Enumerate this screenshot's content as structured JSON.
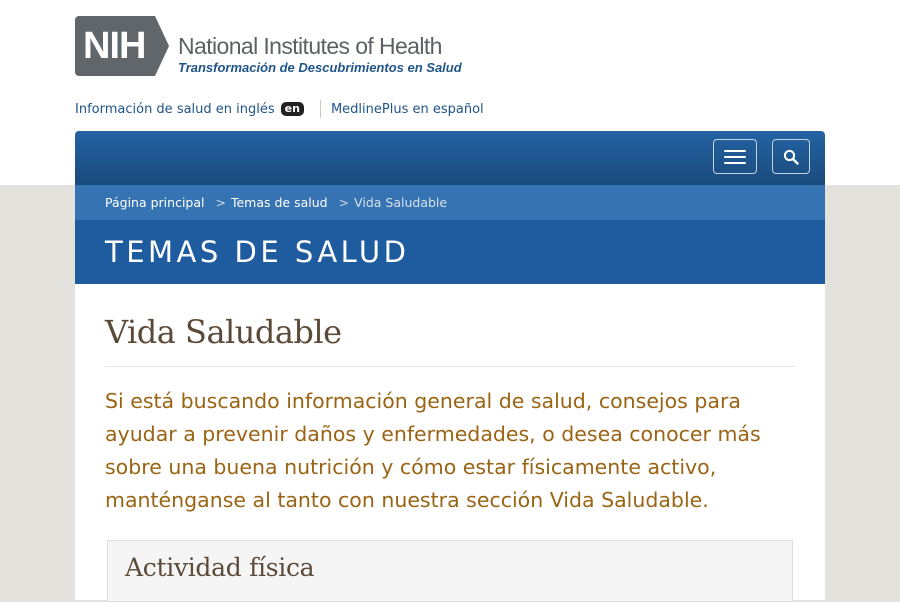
{
  "header": {
    "logo_mark": "NIH",
    "logo_title": "National Institutes of Health",
    "logo_tagline": "Transformación de Descubrimientos en Salud",
    "lang_link_english": "Información de salud en inglés",
    "en_badge": "en",
    "lang_link_medlineplus": "MedlinePlus en español",
    "colors": {
      "logo_gray": "#61666b",
      "brand_blue": "#20558a"
    }
  },
  "navbar": {
    "menu_icon": "hamburger-menu-icon",
    "search_icon": "search-icon",
    "color": "#1f5c9f"
  },
  "breadcrumb": {
    "items": [
      "Página principal",
      "Temas de salud"
    ],
    "separator": ">",
    "current": "Vida Saludable"
  },
  "section": {
    "title": "TEMAS DE SALUD"
  },
  "main": {
    "title": "Vida Saludable",
    "intro": "Si está buscando información general de salud, consejos para ayudar a prevenir daños y enfermedades, o desea conocer más sobre una buena nutrición y cómo estar físicamente activo, manténganse al tanto con nuestra sección Vida Saludable.",
    "intro_color": "#9a6414",
    "panels": [
      {
        "title": "Actividad física"
      }
    ]
  }
}
